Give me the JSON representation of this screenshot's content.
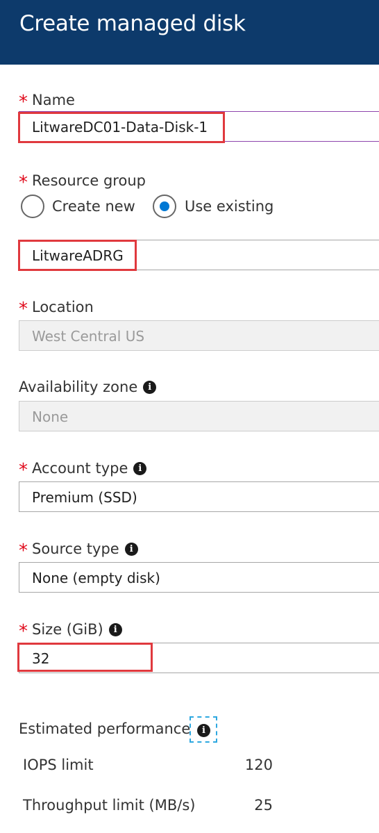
{
  "header": {
    "title": "Create managed disk"
  },
  "name": {
    "label": "Name",
    "value": "LitwareDC01-Data-Disk-1"
  },
  "resource_group": {
    "label": "Resource group",
    "options": [
      {
        "label": "Create new",
        "selected": false
      },
      {
        "label": "Use existing",
        "selected": true
      }
    ],
    "value": "LitwareADRG"
  },
  "location": {
    "label": "Location",
    "value": "West Central US"
  },
  "availability_zone": {
    "label": "Availability zone",
    "value": "None"
  },
  "account_type": {
    "label": "Account type",
    "value": "Premium (SSD)"
  },
  "source_type": {
    "label": "Source type",
    "value": "None (empty disk)"
  },
  "size": {
    "label": "Size (GiB)",
    "value": "32"
  },
  "performance": {
    "title": "Estimated performance",
    "rows": [
      {
        "label": "IOPS limit",
        "value": "120"
      },
      {
        "label": "Throughput limit (MB/s)",
        "value": "25"
      }
    ]
  },
  "icons": {
    "info": "info-icon",
    "required": "*"
  },
  "colors": {
    "header_bg": "#0d3a6b",
    "required": "#e00b1c",
    "radio_selected": "#0078d4",
    "highlight": "#e0393e",
    "focus": "#8e44ad"
  }
}
